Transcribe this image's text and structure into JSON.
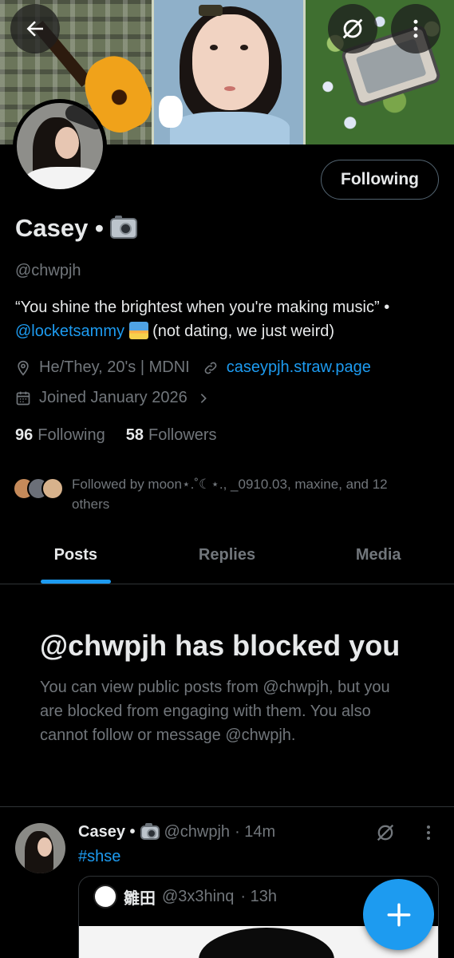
{
  "profile": {
    "name": "Casey •",
    "handle": "@chwpjh",
    "bio_quote": "“You shine the brightest when you're making music” •",
    "bio_mention": "@locketsammy",
    "bio_tail": "(not dating, we just weird)",
    "pronouns_location": "He/They, 20's | MDNI",
    "website": "caseypjh.straw.page",
    "joined": "Joined January 2026",
    "following_count": "96",
    "following_label": "Following",
    "followers_count": "58",
    "followers_label": "Followers",
    "followed_by": "Followed by moon⋆.˚☾⋆., _0910.03, maxine, and 12 others"
  },
  "follow_button": {
    "label": "Following"
  },
  "tabs": [
    {
      "label": "Posts",
      "active": true
    },
    {
      "label": "Replies",
      "active": false
    },
    {
      "label": "Media",
      "active": false
    }
  ],
  "blocked": {
    "title": "@chwpjh has blocked you",
    "description": "You can view public posts from @chwpjh, but you are blocked from engaging with them. You also cannot follow or message @chwpjh."
  },
  "post": {
    "author_name": "Casey •",
    "author_handle": "@chwpjh",
    "time": "· 14m",
    "hashtag": "#shse",
    "quote": {
      "author_name": "雛田",
      "author_handle": "@3x3hinq",
      "time": "· 13h"
    }
  },
  "colors": {
    "accent": "#1d9bf0",
    "background": "#000000",
    "muted_text": "#71767b",
    "primary_text": "#e7e9ea"
  },
  "icons": {
    "back": "arrow-left-icon",
    "grok": "grok-icon",
    "more": "more-vertical-icon",
    "location": "location-pin-icon",
    "link": "link-icon",
    "calendar": "calendar-icon",
    "compose": "plus-icon"
  }
}
